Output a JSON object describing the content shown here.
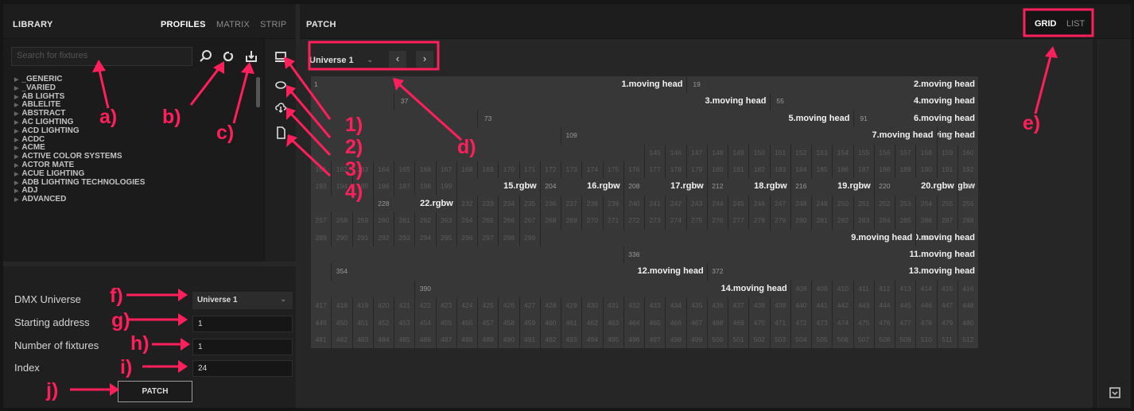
{
  "library": {
    "title": "LIBRARY",
    "tabs": [
      "PROFILES",
      "MATRIX",
      "STRIP"
    ],
    "active_tab": 0,
    "search_placeholder": "Search for fixtures",
    "fixtures": [
      "_GENERIC",
      "_VARIED",
      "AB LIGHTS",
      "ABLELITE",
      "ABSTRACT",
      "AC LIGHTING",
      "ACD LIGHTING",
      "ACDC",
      "ACME",
      "ACTIVE COLOR SYSTEMS",
      "ACTOR MATE",
      "ACUE LIGHTING",
      "ADB LIGHTING TECHNOLOGIES",
      "ADJ",
      "ADVANCED"
    ]
  },
  "patch": {
    "title": "PATCH",
    "view_tabs": [
      "GRID",
      "LIST"
    ],
    "active_view": 0,
    "universe": "Universe 1",
    "prev": "‹",
    "next": "›"
  },
  "form": {
    "labels": [
      "DMX Universe",
      "Starting address",
      "Number of fixtures",
      "Index"
    ],
    "universe_value": "Universe 1",
    "starting_address": "1",
    "number_of_fixtures": "1",
    "index": "24",
    "patch_button": "PATCH"
  },
  "annotations": [
    "a)",
    "b)",
    "c)",
    "1)",
    "2)",
    "3)",
    "4)",
    "d)",
    "e)",
    "f)",
    "g)",
    "h)",
    "i)",
    "j)"
  ],
  "colors": {
    "accent": "#ff1f5a",
    "panel": "#1d1d1d",
    "cell": "#383838"
  }
}
